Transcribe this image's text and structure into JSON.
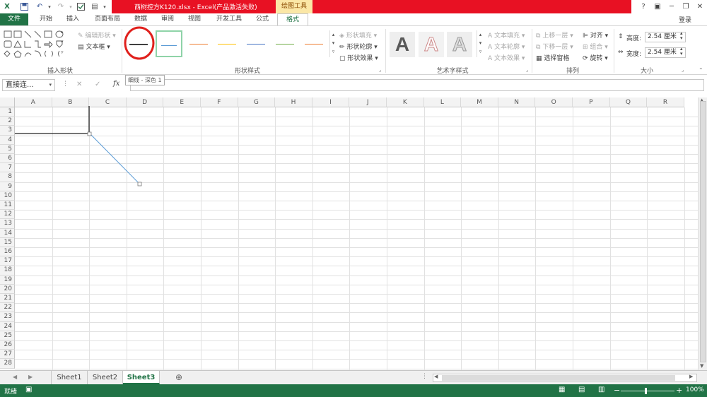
{
  "titlebar": {
    "title": "西树控方K120.xlsx - Excel(产品激活失败)",
    "context_tab_group": "绘图工具",
    "minimize": "─",
    "restore": "❐",
    "close": "✕",
    "help": "?"
  },
  "tabs": [
    {
      "label": "文件"
    },
    {
      "label": "开始"
    },
    {
      "label": "插入"
    },
    {
      "label": "页面布局"
    },
    {
      "label": "数据"
    },
    {
      "label": "审阅"
    },
    {
      "label": "视图"
    },
    {
      "label": "开发工具"
    },
    {
      "label": "公式"
    },
    {
      "label": "格式"
    }
  ],
  "login": "登录",
  "ribbon": {
    "insert_shapes": {
      "label": "插入形状",
      "edit_shape": "编辑形状",
      "text_box": "文本框"
    },
    "shape_styles": {
      "label": "形状样式",
      "fill": "形状填充",
      "outline": "形状轮廓",
      "effects": "形状效果",
      "line_colors": [
        "#3f3f3f",
        "#5b9bd5",
        "#ed7d31",
        "#ffc000",
        "#4472c4",
        "#70ad47",
        "#ed7d31"
      ]
    },
    "wordart": {
      "label": "艺术字样式",
      "glyph": "A",
      "text_fill": "文本填充",
      "text_outline": "文本轮廓",
      "text_effects": "文本效果"
    },
    "arrange": {
      "label": "排列",
      "bring_forward": "上移一层",
      "send_backward": "下移一层",
      "selection_pane": "选择窗格",
      "align": "对齐",
      "group": "组合",
      "rotate": "旋转"
    },
    "size": {
      "label": "大小",
      "height_label": "高度:",
      "height_value": "2.54 厘米",
      "width_label": "宽度:",
      "width_value": "2.54 厘米"
    }
  },
  "formula_bar": {
    "name_box": "直接连...",
    "cancel": "✕",
    "enter": "✓",
    "fx": "fx",
    "value": "",
    "tooltip": "细线 - 深色 1"
  },
  "grid": {
    "columns": [
      "A",
      "B",
      "C",
      "D",
      "E",
      "F",
      "G",
      "H",
      "I",
      "J",
      "K",
      "L",
      "M",
      "N",
      "O",
      "P",
      "Q",
      "R"
    ],
    "rows": [
      "1",
      "2",
      "3",
      "4",
      "5",
      "6",
      "7",
      "8",
      "9",
      "10",
      "11",
      "12",
      "13",
      "14",
      "15",
      "16",
      "17",
      "18",
      "19",
      "20",
      "21",
      "22",
      "23",
      "24",
      "25",
      "26",
      "27",
      "28"
    ]
  },
  "sheets": {
    "tabs": [
      "Sheet1",
      "Sheet2",
      "Sheet3"
    ],
    "active": "Sheet3",
    "add": "⊕"
  },
  "status": {
    "ready": "就绪",
    "zoom": "100%",
    "zoom_minus": "−",
    "zoom_plus": "+"
  }
}
